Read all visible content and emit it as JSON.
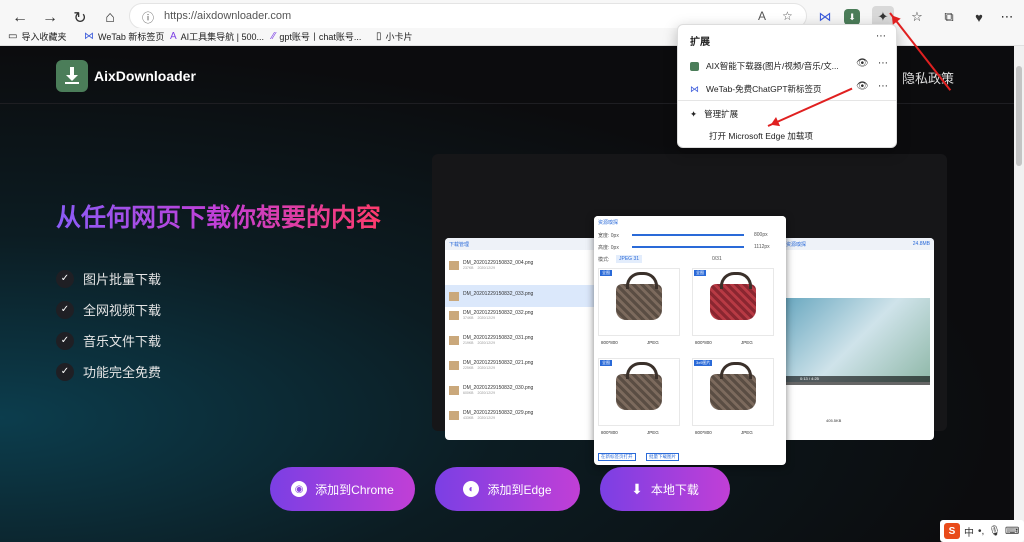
{
  "browser": {
    "url": "https://aixdownloader.com",
    "bookmarks": [
      "导入收藏夹",
      "WeTab 新标签页",
      "AI工具集导航 | 500...",
      "gpt账号丨chat账号...",
      "小卡片"
    ]
  },
  "site": {
    "brand": "AixDownloader",
    "privacy_link": "隐私政策",
    "hero_title": "从任何网页下载你想要的内容",
    "features": [
      "图片批量下载",
      "全网视频下载",
      "音乐文件下载",
      "功能完全免费"
    ],
    "cta_buttons": [
      "添加到Chrome",
      "添加到Edge",
      "本地下载"
    ]
  },
  "preview": {
    "left_window": {
      "title": "下载管理",
      "files": [
        {
          "name": "DM_20201229150832_004.png",
          "size": "237KB",
          "date": "2020/12/29"
        },
        {
          "name": "DM_20201229150832_033.png",
          "size": "",
          "date": ""
        },
        {
          "name": "DM_20201229150832_032.png",
          "size": "374KB",
          "date": "2020/12/29"
        },
        {
          "name": "DM_20201229150832_031.png",
          "size": "219KB",
          "date": "2020/12/29"
        },
        {
          "name": "DM_20201229150832_021.png",
          "size": "225KB",
          "date": "2020/12/29"
        },
        {
          "name": "DM_20201229150832_030.png",
          "size": "600KB",
          "date": "2020/12/29"
        },
        {
          "name": "DM_20201229150832_029.png",
          "size": "433KB",
          "date": "2020/12/29"
        }
      ]
    },
    "middle_window": {
      "title": "资源嗅探",
      "width_label": "宽度: 0px",
      "width_max": "800px",
      "height_label": "高度: 0px",
      "height_max": "1112px",
      "mode_label": "模式:",
      "format": "JPEG 31",
      "count": "0/31",
      "tiles": [
        {
          "badge": "全图",
          "dims": "800*800",
          "format": "JPEG"
        },
        {
          "badge": "全图",
          "dims": "800*800",
          "format": "JPEG"
        },
        {
          "badge": "全图",
          "dims": "800*800",
          "format": "JPEG"
        },
        {
          "badge": "3x9图片",
          "dims": "800*800",
          "format": "JPEG"
        }
      ],
      "footer_buttons": [
        "在新标签页打开",
        "批量下载图片"
      ]
    },
    "right_window": {
      "title": "资源嗅探",
      "size": "24.8MB",
      "video_time": "0:13 / 4:25",
      "file_size": "405.5KB"
    }
  },
  "extensions_popup": {
    "title": "扩展",
    "items": [
      {
        "label": "AIX智能下载器(图片/视频/音乐/文..."
      },
      {
        "label": "WeTab-免费ChatGPT新标签页"
      }
    ],
    "manage": "管理扩展",
    "open_addons": "打开 Microsoft Edge 加载项"
  },
  "ime": {
    "mode": "中"
  }
}
